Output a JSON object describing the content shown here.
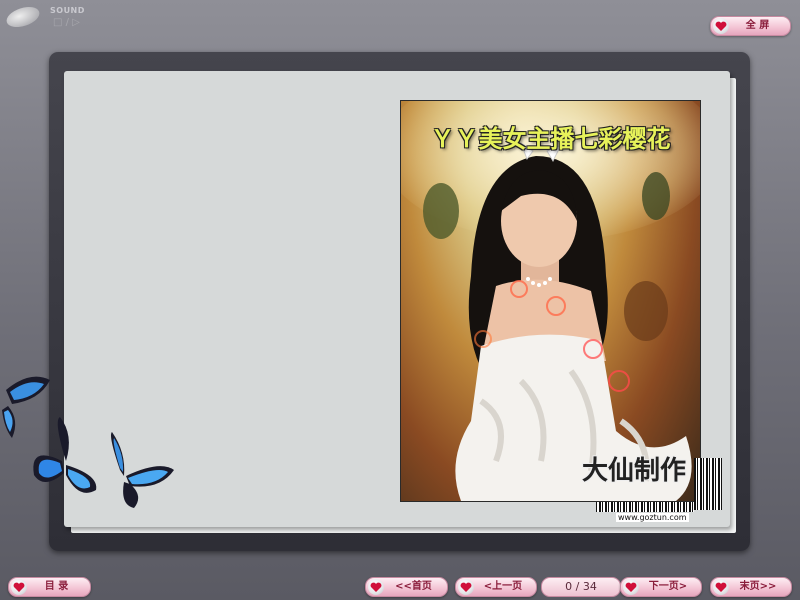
{
  "sound": {
    "label": "SOUND",
    "controls": "□ / ▷"
  },
  "fullscreen": {
    "label": "全 屏"
  },
  "cover": {
    "title": "ＹＹ美女主播七彩樱花",
    "signature": "大仙制作",
    "barcode_url": "www.goztun.com"
  },
  "nav": {
    "toc": "目 录",
    "first": "<<首页",
    "prev": "<上一页",
    "counter": "0 / 34",
    "next": "下一页>",
    "last": "末页>>"
  },
  "colors": {
    "button_text": "#8a1d3b",
    "page_bg": "#d6d9d9",
    "frame": "#3a3a42",
    "title_yellow": "#e7f25a"
  },
  "icons": {
    "button": "heart-icon",
    "sound": "cd-icon"
  }
}
